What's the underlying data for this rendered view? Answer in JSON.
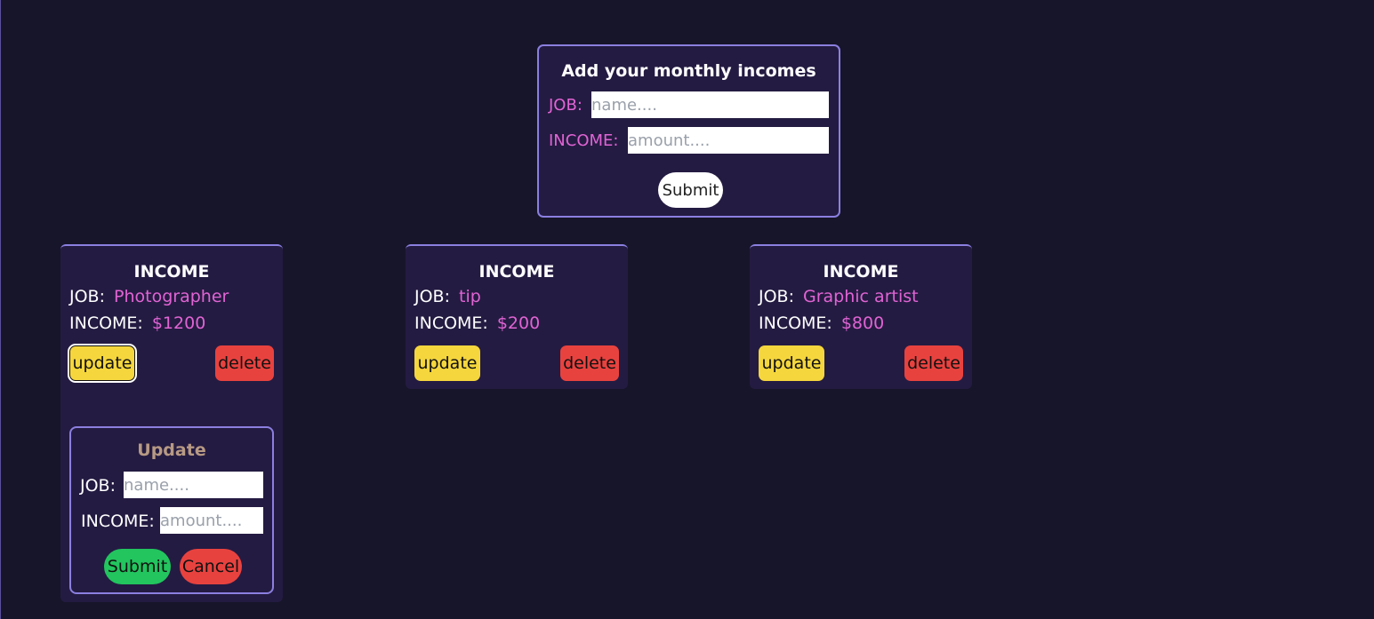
{
  "add_form": {
    "title": "Add your monthly incomes",
    "job_label": "JOB:",
    "job_placeholder": "name....",
    "income_label": "INCOME:",
    "income_placeholder": "amount....",
    "submit_label": "Submit"
  },
  "cards": [
    {
      "title": "INCOME",
      "job_key": "JOB:",
      "job_value": "Photographer",
      "income_key": "INCOME:",
      "income_value": "$1200",
      "update_label": "update",
      "delete_label": "delete"
    },
    {
      "title": "INCOME",
      "job_key": "JOB:",
      "job_value": "tip",
      "income_key": "INCOME:",
      "income_value": "$200",
      "update_label": "update",
      "delete_label": "delete"
    },
    {
      "title": "INCOME",
      "job_key": "JOB:",
      "job_value": "Graphic artist",
      "income_key": "INCOME:",
      "income_value": "$800",
      "update_label": "update",
      "delete_label": "delete"
    }
  ],
  "update_form": {
    "title": "Update",
    "job_label": "JOB:",
    "job_placeholder": "name....",
    "income_label": "INCOME:",
    "income_placeholder": "amount....",
    "submit_label": "Submit",
    "cancel_label": "Cancel"
  },
  "colors": {
    "background": "#17152a",
    "panel": "#241b42",
    "border": "#8b7fe0",
    "accent_pink": "#e064d4",
    "update_yellow": "#f5d63d",
    "delete_red": "#e8423f",
    "submit_green": "#22c55e"
  }
}
